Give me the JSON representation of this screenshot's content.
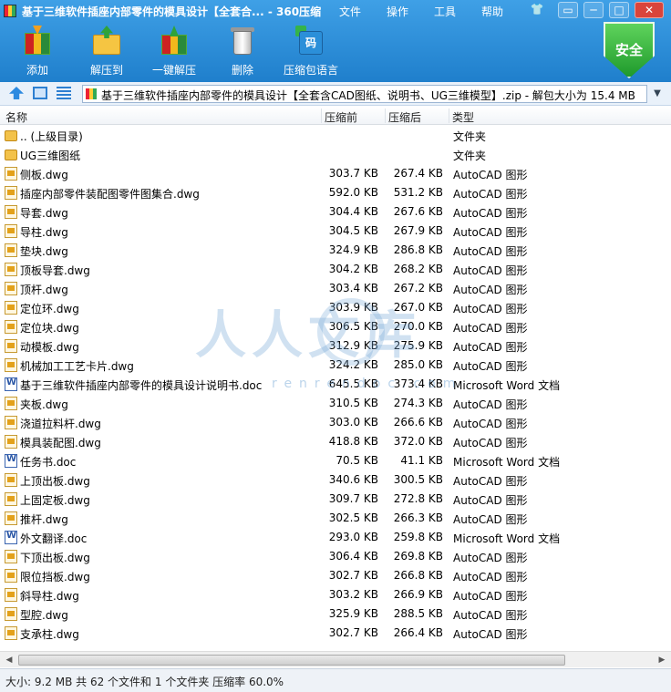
{
  "window": {
    "title": "基于三维软件插座内部零件的模具设计【全套合... - 360压缩",
    "menu": [
      "文件",
      "操作",
      "工具",
      "帮助"
    ],
    "controls": {
      "skin": "👕",
      "menu": "▭",
      "minimize": "─",
      "maximize": "□",
      "close": "✕"
    }
  },
  "toolbar": {
    "buttons": [
      {
        "label": "添加",
        "icon": "add-archive-icon"
      },
      {
        "label": "解压到",
        "icon": "extract-to-icon"
      },
      {
        "label": "一键解压",
        "icon": "one-click-extract-icon"
      },
      {
        "label": "删除",
        "icon": "delete-icon"
      },
      {
        "label": "压缩包语言",
        "icon": "archive-language-icon"
      }
    ],
    "lang_glyph": "码",
    "security_badge": "安全"
  },
  "address": {
    "path": "基于三维软件插座内部零件的模具设计【全套含CAD图纸、说明书、UG三维模型】.zip - 解包大小为 15.4 MB",
    "dropdown": "▼"
  },
  "columns": [
    "名称",
    "压缩前",
    "压缩后",
    "类型"
  ],
  "rows": [
    {
      "name": ".. (上级目录)",
      "size": "",
      "compressed": "",
      "type": "文件夹",
      "icon": "folder"
    },
    {
      "name": "UG三维图纸",
      "size": "",
      "compressed": "",
      "type": "文件夹",
      "icon": "folder"
    },
    {
      "name": "侧板.dwg",
      "size": "303.7 KB",
      "compressed": "267.4 KB",
      "type": "AutoCAD 图形",
      "icon": "dwg"
    },
    {
      "name": "插座内部零件装配图零件图集合.dwg",
      "size": "592.0 KB",
      "compressed": "531.2 KB",
      "type": "AutoCAD 图形",
      "icon": "dwg"
    },
    {
      "name": "导套.dwg",
      "size": "304.4 KB",
      "compressed": "267.6 KB",
      "type": "AutoCAD 图形",
      "icon": "dwg"
    },
    {
      "name": "导柱.dwg",
      "size": "304.5 KB",
      "compressed": "267.9 KB",
      "type": "AutoCAD 图形",
      "icon": "dwg"
    },
    {
      "name": "垫块.dwg",
      "size": "324.9 KB",
      "compressed": "286.8 KB",
      "type": "AutoCAD 图形",
      "icon": "dwg"
    },
    {
      "name": "顶板导套.dwg",
      "size": "304.2 KB",
      "compressed": "268.2 KB",
      "type": "AutoCAD 图形",
      "icon": "dwg"
    },
    {
      "name": "顶杆.dwg",
      "size": "303.4 KB",
      "compressed": "267.2 KB",
      "type": "AutoCAD 图形",
      "icon": "dwg"
    },
    {
      "name": "定位环.dwg",
      "size": "303.9 KB",
      "compressed": "267.0 KB",
      "type": "AutoCAD 图形",
      "icon": "dwg"
    },
    {
      "name": "定位块.dwg",
      "size": "306.5 KB",
      "compressed": "270.0 KB",
      "type": "AutoCAD 图形",
      "icon": "dwg"
    },
    {
      "name": "动模板.dwg",
      "size": "312.9 KB",
      "compressed": "275.9 KB",
      "type": "AutoCAD 图形",
      "icon": "dwg"
    },
    {
      "name": "机械加工工艺卡片.dwg",
      "size": "324.2 KB",
      "compressed": "285.0 KB",
      "type": "AutoCAD 图形",
      "icon": "dwg"
    },
    {
      "name": "基于三维软件插座内部零件的模具设计说明书.doc",
      "size": "645.5 KB",
      "compressed": "373.4 KB",
      "type": "Microsoft Word 文档",
      "icon": "doc"
    },
    {
      "name": "夹板.dwg",
      "size": "310.5 KB",
      "compressed": "274.3 KB",
      "type": "AutoCAD 图形",
      "icon": "dwg"
    },
    {
      "name": "浇道拉料杆.dwg",
      "size": "303.0 KB",
      "compressed": "266.6 KB",
      "type": "AutoCAD 图形",
      "icon": "dwg"
    },
    {
      "name": "模具装配图.dwg",
      "size": "418.8 KB",
      "compressed": "372.0 KB",
      "type": "AutoCAD 图形",
      "icon": "dwg"
    },
    {
      "name": "任务书.doc",
      "size": "70.5 KB",
      "compressed": "41.1 KB",
      "type": "Microsoft Word 文档",
      "icon": "doc"
    },
    {
      "name": "上顶出板.dwg",
      "size": "340.6 KB",
      "compressed": "300.5 KB",
      "type": "AutoCAD 图形",
      "icon": "dwg"
    },
    {
      "name": "上固定板.dwg",
      "size": "309.7 KB",
      "compressed": "272.8 KB",
      "type": "AutoCAD 图形",
      "icon": "dwg"
    },
    {
      "name": "推杆.dwg",
      "size": "302.5 KB",
      "compressed": "266.3 KB",
      "type": "AutoCAD 图形",
      "icon": "dwg"
    },
    {
      "name": "外文翻译.doc",
      "size": "293.0 KB",
      "compressed": "259.8 KB",
      "type": "Microsoft Word 文档",
      "icon": "doc"
    },
    {
      "name": "下顶出板.dwg",
      "size": "306.4 KB",
      "compressed": "269.8 KB",
      "type": "AutoCAD 图形",
      "icon": "dwg"
    },
    {
      "name": "限位挡板.dwg",
      "size": "302.7 KB",
      "compressed": "266.8 KB",
      "type": "AutoCAD 图形",
      "icon": "dwg"
    },
    {
      "name": "斜导柱.dwg",
      "size": "303.2 KB",
      "compressed": "266.9 KB",
      "type": "AutoCAD 图形",
      "icon": "dwg"
    },
    {
      "name": "型腔.dwg",
      "size": "325.9 KB",
      "compressed": "288.5 KB",
      "type": "AutoCAD 图形",
      "icon": "dwg"
    },
    {
      "name": "支承柱.dwg",
      "size": "302.7 KB",
      "compressed": "266.4 KB",
      "type": "AutoCAD 图形",
      "icon": "dwg"
    }
  ],
  "watermark": {
    "main": "人人文库",
    "sub": "renrendoc.com"
  },
  "status": "大小: 9.2 MB 共 62 个文件和 1 个文件夹 压缩率 60.0%",
  "scroll": {
    "left": "◀",
    "right": "▶"
  }
}
